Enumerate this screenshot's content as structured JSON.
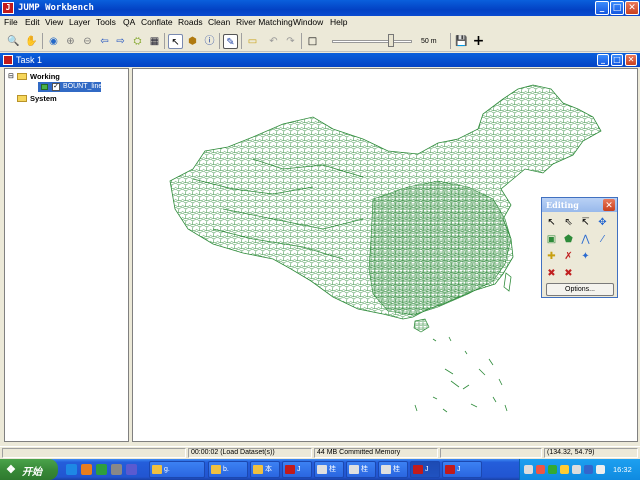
{
  "app": {
    "title": "JUMP Workbench",
    "icon_label": "J"
  },
  "window_controls": {
    "minimize": "_",
    "maximize": "□",
    "close": "✕"
  },
  "menu": {
    "items": [
      "File",
      "Edit",
      "View",
      "Layer",
      "Tools",
      "QA",
      "Conflate",
      "Roads",
      "Clean",
      "River Matching",
      "Window",
      "Help"
    ]
  },
  "toolbar": {
    "icons": [
      "zoom-icon",
      "pan-hand-icon",
      "zoom-to-full-extent-icon",
      "zoom-in-icon",
      "zoom-out-icon",
      "zoom-previous-icon",
      "zoom-next-icon",
      "zoom-to-selected-icon",
      "zoom-to-fence-icon",
      "select-arrow-icon",
      "fence-box-icon",
      "info-icon",
      "edit-toggle-icon",
      "measure-icon",
      "undo-icon",
      "redo-icon",
      "scale-box-icon",
      "save-icon",
      "add-point-icon"
    ],
    "scale_label": "50 m",
    "scale_value_fraction": 0.75
  },
  "task": {
    "title": "Task 1"
  },
  "tree": {
    "categories": [
      {
        "name": "Working",
        "layers": [
          {
            "name": "BOUNT_line",
            "checked": true
          }
        ]
      },
      {
        "name": "System",
        "layers": []
      }
    ]
  },
  "editing": {
    "title": "Editing",
    "close": "✕",
    "tools": [
      "select-features-icon",
      "select-parts-icon",
      "select-line-strings-icon",
      "move-selected-icon",
      "draw-rectangle-icon",
      "draw-polygon-icon",
      "draw-linestring-icon",
      "draw-point-icon",
      "move-vertex-icon",
      "delete-vertex-icon",
      "snap-vertex-icon",
      "insert-vertex-icon",
      "split-icon",
      "merge-icon"
    ],
    "options_label": "Options..."
  },
  "status": {
    "message": "",
    "time": "00:00:02 (Load Dataset(s))",
    "memory": "44 MB Committed Memory",
    "empty": "",
    "coordinates": "(134.32, 54.79)"
  },
  "taskbar": {
    "start_label": "开始",
    "tasks": [
      {
        "label": "g.",
        "active": false
      },
      {
        "label": "b.",
        "active": false
      },
      {
        "label": "本",
        "active": false
      },
      {
        "label": "J",
        "active": false
      },
      {
        "label": "桂",
        "active": false
      },
      {
        "label": "桂",
        "active": false
      },
      {
        "label": "桂",
        "active": false
      },
      {
        "label": "J",
        "active": true
      },
      {
        "label": "J",
        "active": false
      }
    ],
    "clock": "16:32"
  },
  "colors": {
    "map_lines": "#2e8b3a",
    "titlebar": "#0a5fdc",
    "tray": "#1da0f0"
  }
}
